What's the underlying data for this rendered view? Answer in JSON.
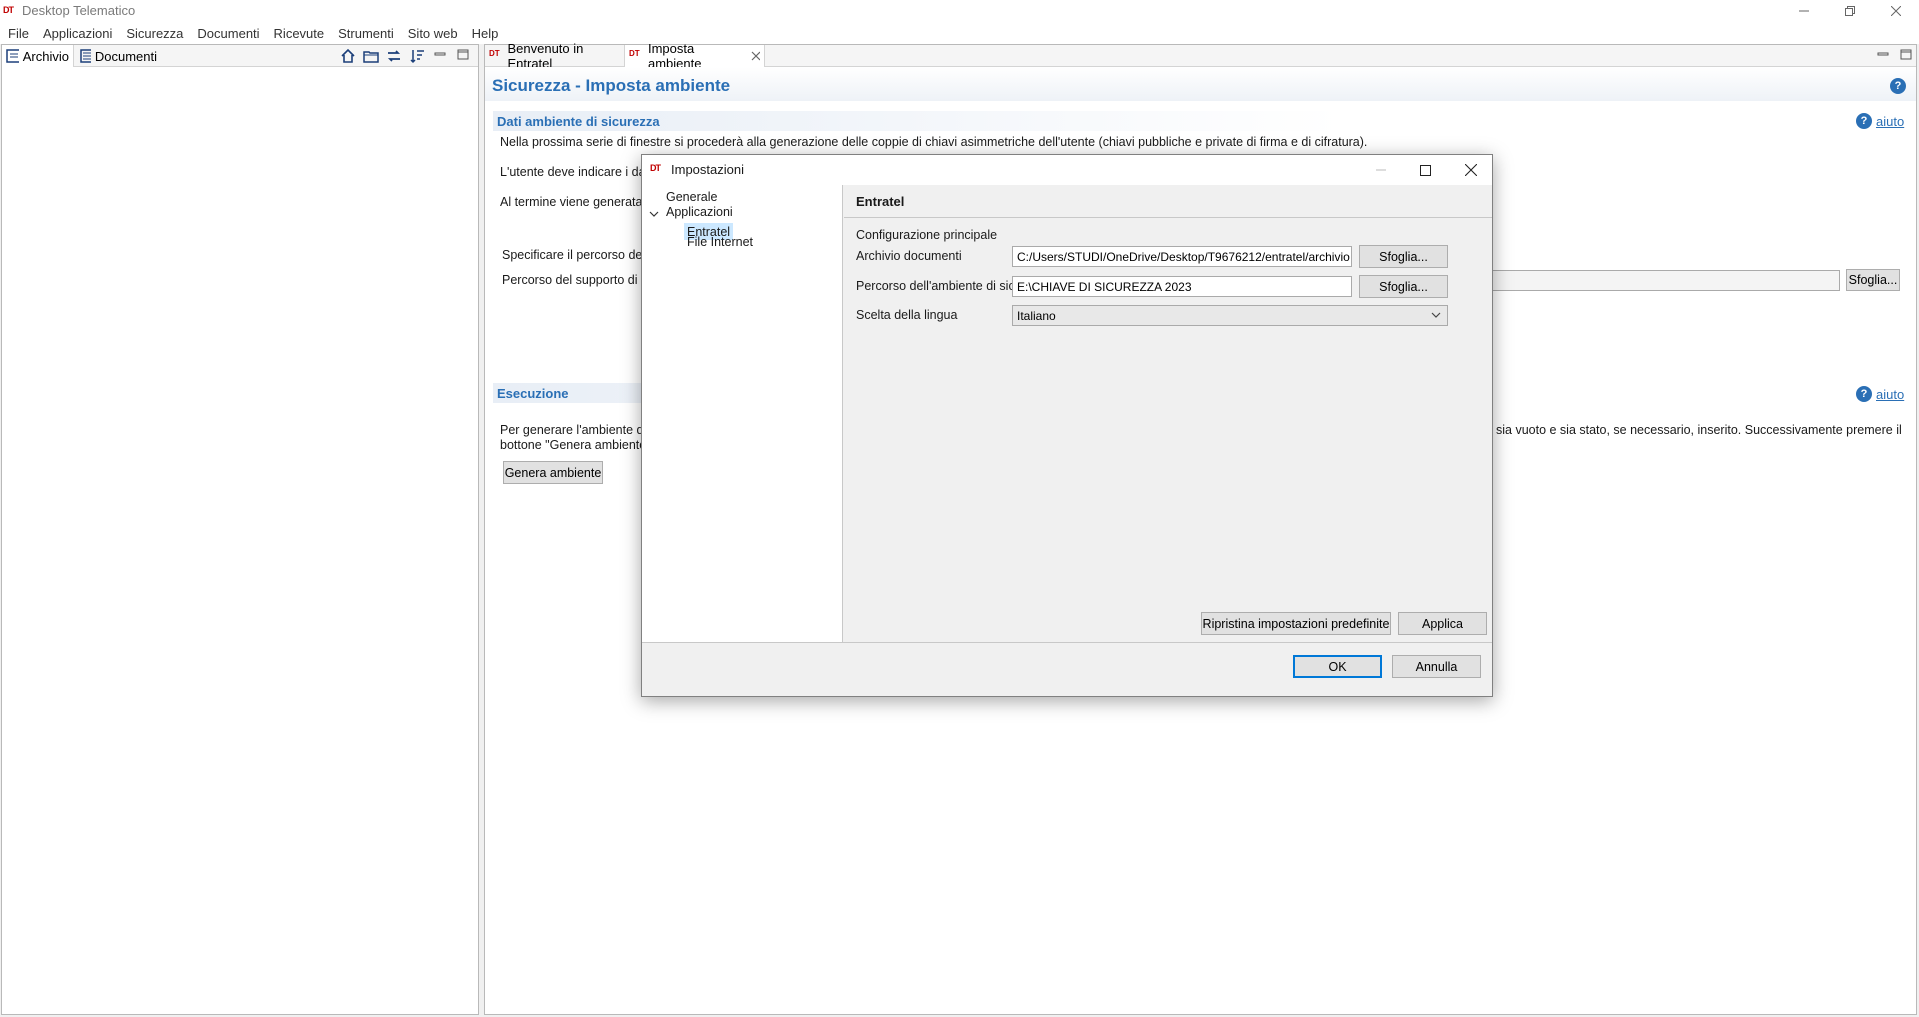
{
  "window": {
    "title": "Desktop Telematico",
    "logo_text": "DT"
  },
  "menubar": {
    "items": [
      "File",
      "Applicazioni",
      "Sicurezza",
      "Documenti",
      "Ricevute",
      "Strumenti",
      "Sito web",
      "Help"
    ]
  },
  "left_view": {
    "tabs": [
      "Archivio",
      "Documenti"
    ],
    "toolbar_icons": [
      "home-icon",
      "folder-icon",
      "sync-icon",
      "sort-icon",
      "minimize-icon",
      "maximize-icon"
    ]
  },
  "editor": {
    "tabs": [
      "Benvenuto in Entratel",
      "Imposta ambiente"
    ],
    "page_title": "Sicurezza - Imposta ambiente",
    "section1": {
      "title": "Dati ambiente di sicurezza",
      "help_label": "aiuto",
      "line1": "Nella  prossima serie di finestre  si procederà  alla generazione delle coppie di chiavi asimmetriche dell'utente (chiavi pubbliche e private di firma e di cifratura).",
      "line2": "L'utente deve indicare i dat",
      "line3": "Al termine viene generata l",
      "label_path": "Specificare il percorso del s",
      "label_support": "Percorso del supporto di si",
      "browse_label": "Sfoglia..."
    },
    "section2": {
      "title": "Esecuzione",
      "help_label": "aiuto",
      "text_left_1": "Per generare l'ambiente di",
      "text_left_2": "bottone \"Genera ambiente",
      "text_right": "sia vuoto e sia stato, se necessario, inserito. Successivamente premere il",
      "button_label": "Genera ambiente"
    }
  },
  "dialog": {
    "title": "Impostazioni",
    "logo_text": "DT",
    "tree": {
      "generale": "Generale",
      "applicazioni": "Applicazioni",
      "entratel": "Entratel",
      "file_internet": "File Internet"
    },
    "page_title": "Entratel",
    "group_label": "Configurazione principale",
    "fields": {
      "archivio_label": "Archivio documenti",
      "archivio_value": "C:/Users/STUDI/OneDrive/Desktop/T9676212/entratel/archivio",
      "percorso_label": "Percorso dell'ambiente di sicurezza",
      "percorso_value": "E:\\CHIAVE DI SICUREZZA 2023",
      "lingua_label": "Scelta della lingua",
      "lingua_value": "Italiano",
      "browse_label": "Sfoglia..."
    },
    "buttons": {
      "restore": "Ripristina impostazioni predefinite",
      "apply": "Applica",
      "ok": "OK",
      "cancel": "Annulla"
    }
  },
  "colors": {
    "accent_blue": "#2a6fb5",
    "selection": "#cce8ff",
    "logo_red": "#c00000"
  }
}
